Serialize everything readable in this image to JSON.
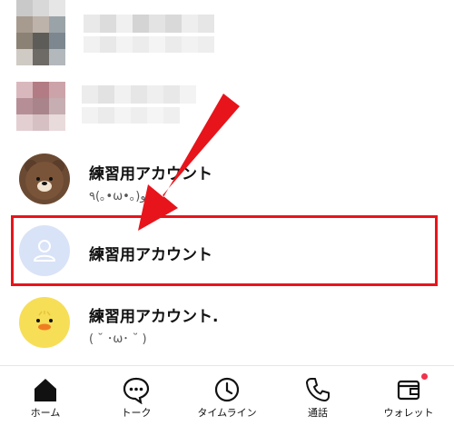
{
  "contacts": [
    {
      "name": "",
      "status": "",
      "blurred": true
    },
    {
      "name": "",
      "status": "",
      "blurred": true
    },
    {
      "name": "練習用アカウント",
      "status": "٩(｡•ω•｡)و",
      "avatar": "bear-avatar-icon"
    },
    {
      "name": "練習用アカウント",
      "status": "",
      "avatar": "default-person-avatar-icon"
    },
    {
      "name": "練習用アカウント.",
      "status": "( ˘ ･ω･ ˘ )",
      "avatar": "duck-avatar-icon"
    }
  ],
  "annotation": {
    "arrow_color": "#e8141b",
    "highlight_color": "#e8141b"
  },
  "bottom_nav": [
    {
      "label": "ホーム",
      "icon": "home-icon"
    },
    {
      "label": "トーク",
      "icon": "chat-bubble-icon"
    },
    {
      "label": "タイムライン",
      "icon": "clock-icon"
    },
    {
      "label": "通話",
      "icon": "phone-icon"
    },
    {
      "label": "ウォレット",
      "icon": "wallet-icon",
      "badge": true
    }
  ]
}
